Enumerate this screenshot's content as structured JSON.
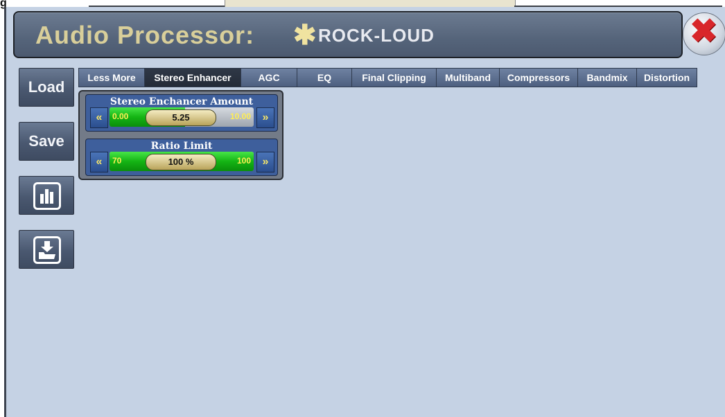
{
  "top_fragment": "g",
  "header": {
    "label": "Audio Processor:",
    "modified_marker": "✱",
    "preset_name": "ROCK-LOUD"
  },
  "close_icon": "close-x-icon",
  "sidebar": {
    "load_label": "Load",
    "save_label": "Save",
    "icons": [
      "bar-chart-icon",
      "download-file-icon"
    ]
  },
  "tabs": [
    {
      "label": "Less More",
      "active": false
    },
    {
      "label": "Stereo Enhancer",
      "active": true
    },
    {
      "label": "AGC",
      "active": false
    },
    {
      "label": "EQ",
      "active": false
    },
    {
      "label": "Final Clipping",
      "active": false
    },
    {
      "label": "Multiband",
      "active": false
    },
    {
      "label": "Compressors",
      "active": false
    },
    {
      "label": "Bandmix",
      "active": false
    },
    {
      "label": "Distortion",
      "active": false
    }
  ],
  "controls": [
    {
      "title": "Stereo Enchancer Amount",
      "min": "0.00",
      "max": "10.00",
      "value": "5.25",
      "fill_fraction": 0.525,
      "decrease_symbol": "«",
      "increase_symbol": "»"
    },
    {
      "title": "Ratio Limit",
      "min": "70",
      "max": "100",
      "value": "100 %",
      "fill_fraction": 1.0,
      "decrease_symbol": "«",
      "increase_symbol": "»"
    }
  ],
  "colors": {
    "background": "#c5d2e4",
    "header_label": "#d9cf9a",
    "slider_fill": "#14b414",
    "arrow_symbol": "#f3e36a",
    "close_x": "#d8262a"
  }
}
